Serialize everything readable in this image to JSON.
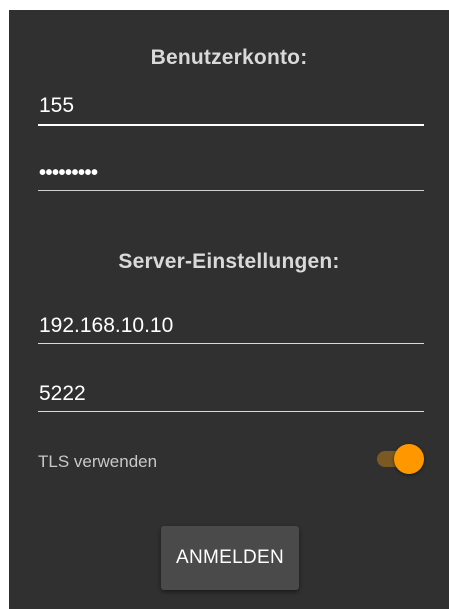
{
  "account": {
    "title": "Benutzerkonto:",
    "username_value": "155",
    "password_masked": "•••••••••"
  },
  "server": {
    "title": "Server-Einstellungen:",
    "host_value": "192.168.10.10",
    "port_value": "5222"
  },
  "tls": {
    "label": "TLS verwenden",
    "enabled": true
  },
  "actions": {
    "login_label": "ANMELDEN"
  },
  "colors": {
    "background": "#303030",
    "accent": "#ff9800",
    "toggle_track_on": "#7a5a22",
    "button_background": "#4a4a4a"
  },
  "icons": {
    "toggle": "switch-on-icon"
  }
}
